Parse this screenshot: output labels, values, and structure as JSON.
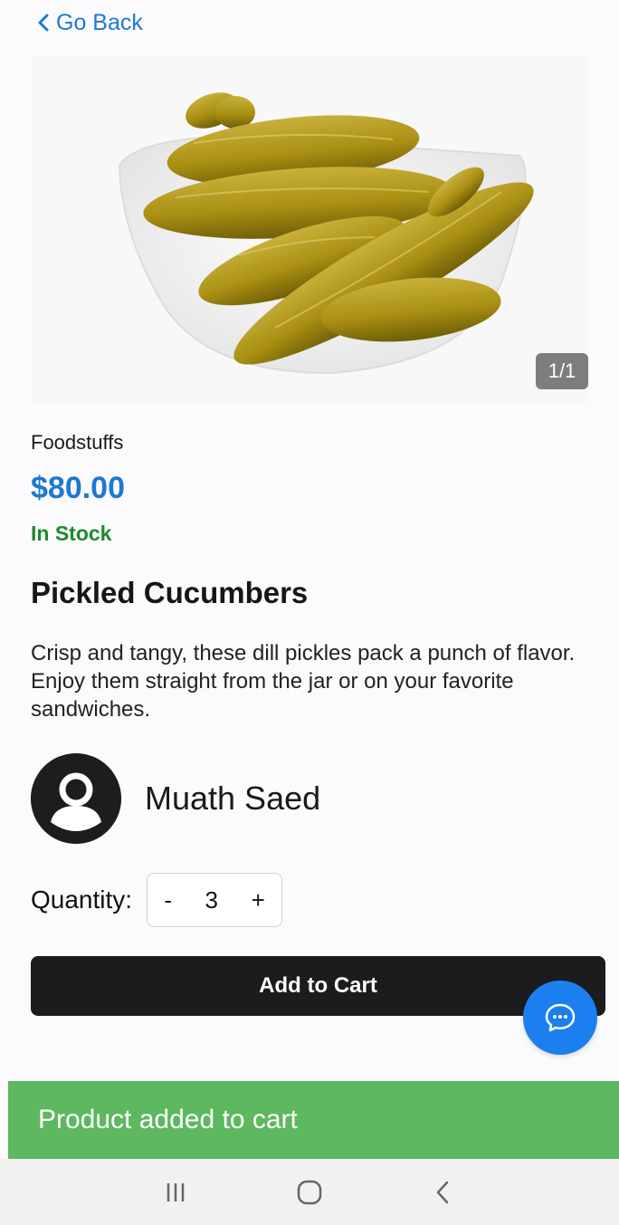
{
  "nav": {
    "back_label": "Go Back"
  },
  "gallery": {
    "counter": "1/1"
  },
  "product": {
    "category": "Foodstuffs",
    "price": "$80.00",
    "stock_status": "In Stock",
    "title": "Pickled Cucumbers",
    "description": "Crisp and tangy, these dill pickles pack a punch of flavor. Enjoy them straight from the jar or on your favorite sandwiches."
  },
  "seller": {
    "name": "Muath Saed"
  },
  "quantity": {
    "label": "Quantity:",
    "minus": "-",
    "value": "3",
    "plus": "+"
  },
  "actions": {
    "add_to_cart": "Add to Cart"
  },
  "toast": {
    "message": "Product added to cart"
  },
  "colors": {
    "accent": "#1e78d2",
    "stock": "#1f8a2c",
    "button": "#1c1c1f",
    "chat": "#1b7ff0",
    "toast": "#5db85f"
  },
  "icons": {
    "back": "chevron-left-icon",
    "chat": "chat-bubble-icon",
    "avatar": "user-icon",
    "recents": "recents-icon",
    "home": "home-icon",
    "system_back": "back-icon"
  }
}
